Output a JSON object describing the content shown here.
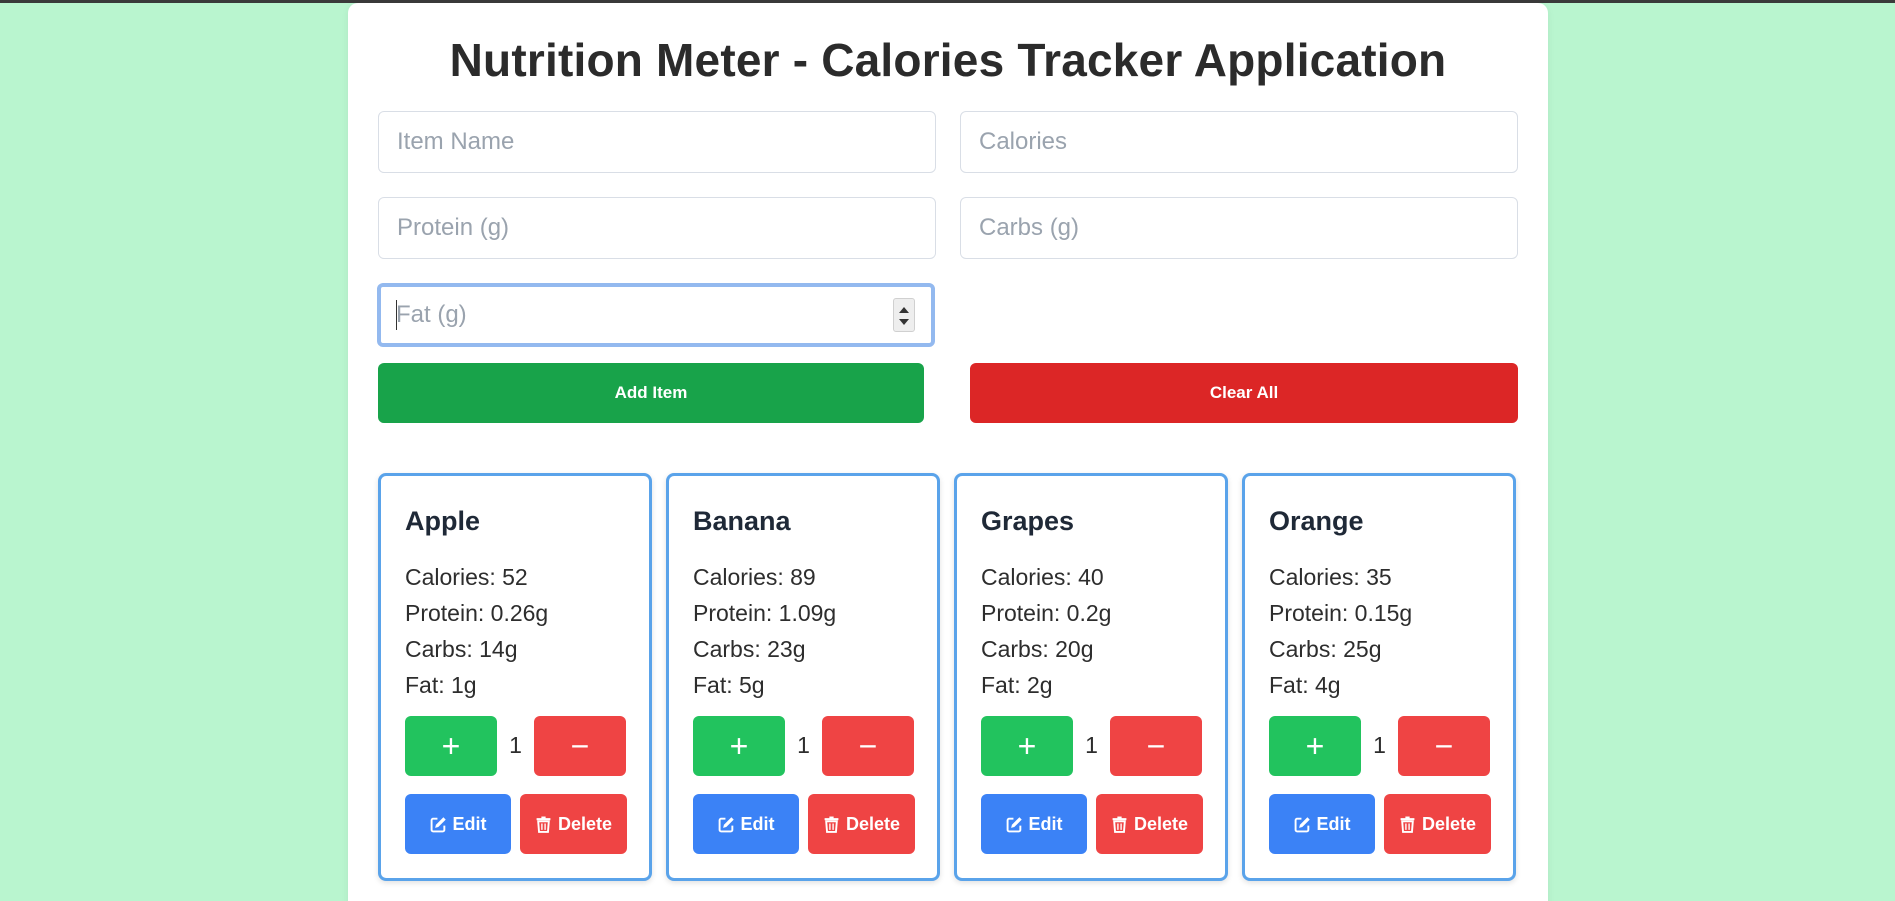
{
  "app": {
    "title": "Nutrition Meter - Calories Tracker Application"
  },
  "form": {
    "item_name_placeholder": "Item Name",
    "calories_placeholder": "Calories",
    "protein_placeholder": "Protein (g)",
    "carbs_placeholder": "Carbs (g)",
    "fat_placeholder": "Fat (g)",
    "add_label": "Add Item",
    "clear_label": "Clear All"
  },
  "items": [
    {
      "name": "Apple",
      "calories": "Calories: 52",
      "protein": "Protein: 0.26g",
      "carbs": "Carbs: 14g",
      "fat": "Fat: 1g",
      "qty": "1",
      "plus": "+",
      "minus": "−",
      "edit": "Edit",
      "delete": "Delete"
    },
    {
      "name": "Banana",
      "calories": "Calories: 89",
      "protein": "Protein: 1.09g",
      "carbs": "Carbs: 23g",
      "fat": "Fat: 5g",
      "qty": "1",
      "plus": "+",
      "minus": "−",
      "edit": "Edit",
      "delete": "Delete"
    },
    {
      "name": "Grapes",
      "calories": "Calories: 40",
      "protein": "Protein: 0.2g",
      "carbs": "Carbs: 20g",
      "fat": "Fat: 2g",
      "qty": "1",
      "plus": "+",
      "minus": "−",
      "edit": "Edit",
      "delete": "Delete"
    },
    {
      "name": "Orange",
      "calories": "Calories: 35",
      "protein": "Protein: 0.15g",
      "carbs": "Carbs: 25g",
      "fat": "Fat: 4g",
      "qty": "1",
      "plus": "+",
      "minus": "−",
      "edit": "Edit",
      "delete": "Delete"
    }
  ],
  "icons": {
    "edit": "pencil-square-icon",
    "delete": "trash-icon"
  },
  "colors": {
    "background": "#b9f5cf",
    "add": "#18a34a",
    "clear": "#dc2626",
    "plus": "#22c35e",
    "minus": "#ef4444",
    "edit": "#3b82f6",
    "card_border": "#5aa3ea"
  }
}
